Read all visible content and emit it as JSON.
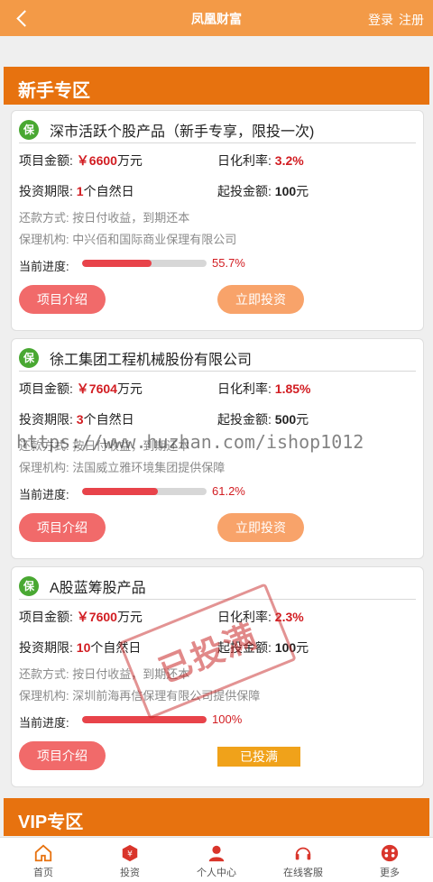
{
  "header": {
    "title": "凤凰财富",
    "login": "登录",
    "register": "注册"
  },
  "sections": {
    "newbie": "新手专区",
    "vip": "VIP专区"
  },
  "labels": {
    "amount": "项目金额:",
    "rate": "日化利率:",
    "period": "投资期限:",
    "min": "起投金额:",
    "repay": "还款方式:",
    "guarantee": "保理机构:",
    "progress": "当前进度:",
    "intro_btn": "项目介绍",
    "invest_btn": "立即投资",
    "full_btn": "已投满",
    "currency": "￥",
    "unit_wan": "万元",
    "unit_day": "个自然日"
  },
  "cards": [
    {
      "badge": "保",
      "name": "深市活跃个股产品（新手专享，限投一次)",
      "amount": "6600",
      "rate": "3.2%",
      "period": "1",
      "min": "100",
      "repay": "按日付收益，到期还本",
      "guarantee": "中兴佰和国际商业保理有限公司",
      "progress": 0.557,
      "progress_text": "55.7%"
    },
    {
      "badge": "保",
      "name": "徐工集团工程机械股份有限公司",
      "amount": "7604",
      "rate": "1.85%",
      "period": "3",
      "min": "500",
      "repay": "按日付收益，到期还本",
      "guarantee": "法国威立雅环境集团提供保障",
      "progress": 0.612,
      "progress_text": "61.2%"
    },
    {
      "badge": "保",
      "name": "A股蓝筹股产品",
      "amount": "7600",
      "rate": "2.3%",
      "period": "10",
      "min": "100",
      "repay": "按日付收益，到期还本",
      "guarantee": "深圳前海再信保理有限公司提供保障",
      "progress": 1.0,
      "progress_text": "100%"
    }
  ],
  "stamp": "已投满",
  "watermark": "https://www.huzhan.com/ishop1012",
  "tabs": [
    {
      "label": "首页",
      "icon": "home-icon"
    },
    {
      "label": "投资",
      "icon": "invest-icon"
    },
    {
      "label": "个人中心",
      "icon": "user-icon"
    },
    {
      "label": "在线客服",
      "icon": "headset-icon"
    },
    {
      "label": "更多",
      "icon": "more-icon"
    }
  ]
}
